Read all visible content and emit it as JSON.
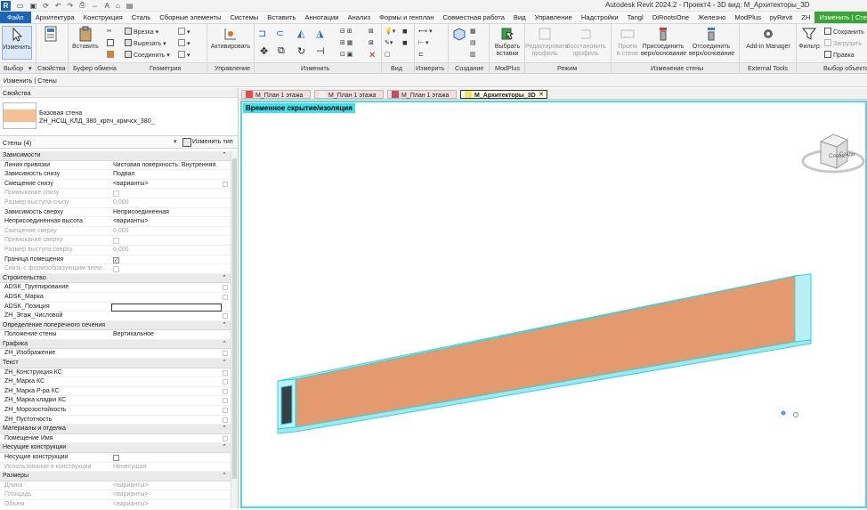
{
  "app": {
    "logo": "R",
    "title": "Autodesk Revit 2024.2 - Проект4 - 3D вид: М_Архитекторы_3D"
  },
  "ribbon_tabs": [
    "Файл",
    "Архитектура",
    "Конструкция",
    "Сталь",
    "Сборные элементы",
    "Системы",
    "Вставить",
    "Аннотации",
    "Анализ",
    "Формы и генплан",
    "Совместная работа",
    "Вид",
    "Управление",
    "Надстройки",
    "Tangl",
    "DiRootsOne",
    "Железно",
    "ModPlus",
    "pyRevit",
    "ZH",
    "Изменить | Стены"
  ],
  "ribbon": {
    "modify": "Изменить",
    "properties": "Свойства",
    "paste": "Вставить",
    "cut": "Врезка",
    "cut2": "Вырезать",
    "join": "Соединить",
    "activate": "Активировать",
    "select_inserts": "Выбрать\nвставки",
    "edit_profile": "Редактировать\nпрофиль",
    "reset_profile": "Восстановить\nпрофиль",
    "wall_opening": "Проем\nв стене",
    "attach": "Присоединить\nверх/основание",
    "detach": "Отсоединить\nверх/основание",
    "addin": "Add-in Manager",
    "filter": "Фильтр",
    "save": "Сохранить",
    "load": "Загрузить",
    "edit": "Правка"
  },
  "panels": [
    "Выбор",
    "Свойства",
    "Буфер обмена",
    "Геометрия",
    "Управление",
    "Изменить",
    "Вид",
    "Измерить",
    "Создание",
    "ModPlus",
    "Режим",
    "Изменение стены",
    "External Tools",
    "Выбор объектов"
  ],
  "options_bar": "Изменить | Стены",
  "properties": {
    "header": "Свойства",
    "type_name": "Базовая стена",
    "type_sub": "ZH_НСЩ_КЛД_380_крпч_крмчск_380_",
    "instance": "Стены (4)",
    "edit_type": "Изменить тип",
    "groups": [
      {
        "name": "Зависимости",
        "rows": [
          {
            "n": "Линия привязки",
            "v": "Чистовая поверхность: Внутренняя",
            "d": false
          },
          {
            "n": "Зависимость снизу",
            "v": "Подвал",
            "d": false
          },
          {
            "n": "Смещение снизу",
            "v": "<варианты>",
            "d": false,
            "box": true
          },
          {
            "n": "Примыкание снизу",
            "v": "",
            "d": true,
            "chk": ""
          },
          {
            "n": "Размер выступа снизу",
            "v": "0,000",
            "d": true
          },
          {
            "n": "Зависимость сверху",
            "v": "Неприсоединенная",
            "d": false
          },
          {
            "n": "Неприсоединенная высота",
            "v": "<варианты>",
            "d": false
          },
          {
            "n": "Смещение сверху",
            "v": "0,000",
            "d": true
          },
          {
            "n": "Примыкание сверху",
            "v": "",
            "d": true,
            "chk": ""
          },
          {
            "n": "Размер выступа сверху",
            "v": "0,000",
            "d": true
          },
          {
            "n": "Граница помещения",
            "v": "",
            "d": false,
            "chk": "✓"
          },
          {
            "n": "Связь с формообразующим элем...",
            "v": "",
            "d": true,
            "chk": ""
          }
        ]
      },
      {
        "name": "Строительство",
        "rows": [
          {
            "n": "ADSK_Группирование",
            "v": "",
            "d": false,
            "box": true
          },
          {
            "n": "ADSK_Марка",
            "v": "",
            "d": false,
            "box": true
          },
          {
            "n": "ADSK_Позиция",
            "v": "",
            "d": false,
            "input": true
          },
          {
            "n": "ZH_Этаж_Числовой",
            "v": "",
            "d": false,
            "box": true
          }
        ]
      },
      {
        "name": "Определение поперечного сечения",
        "rows": [
          {
            "n": "Положение стены",
            "v": "Вертикальное",
            "d": false
          }
        ]
      },
      {
        "name": "Графика",
        "rows": [
          {
            "n": "ZH_Изображение",
            "v": "",
            "d": false,
            "box": true
          }
        ]
      },
      {
        "name": "Текст",
        "rows": [
          {
            "n": "ZH_Конструкция КС",
            "v": "",
            "d": false,
            "box": true
          },
          {
            "n": "ZH_Марка КС",
            "v": "",
            "d": false,
            "box": true
          },
          {
            "n": "ZH_Марка Р-ра КС",
            "v": "",
            "d": false,
            "box": true
          },
          {
            "n": "ZH_Марка кладки КС",
            "v": "",
            "d": false,
            "box": true
          },
          {
            "n": "ZH_Морозостойкость",
            "v": "",
            "d": false,
            "box": true
          },
          {
            "n": "ZH_Пустотность",
            "v": "",
            "d": false,
            "box": true
          }
        ]
      },
      {
        "name": "Материалы и отделка",
        "rows": [
          {
            "n": "Помещение Имя",
            "v": "",
            "d": false,
            "box": true
          }
        ]
      },
      {
        "name": "Несущие конструкции",
        "rows": [
          {
            "n": "Несущие конструкции",
            "v": "",
            "d": false,
            "chk": ""
          },
          {
            "n": "Использование в конструкции",
            "v": "Ненесущая",
            "d": true
          }
        ]
      },
      {
        "name": "Размеры",
        "rows": [
          {
            "n": "Длина",
            "v": "<варианты>",
            "d": true
          },
          {
            "n": "Площадь",
            "v": "<варианты>",
            "d": true
          },
          {
            "n": "Объем",
            "v": "<варианты>",
            "d": true
          }
        ]
      }
    ]
  },
  "view_tabs": [
    {
      "label": "М_План 1 этажа",
      "color": "#e84a4a",
      "active": false
    },
    {
      "label": "М_План 1 этажа",
      "color": "#f0f0f0",
      "active": false
    },
    {
      "label": "М_План 1 этажа",
      "color": "#c24a6a",
      "active": false
    },
    {
      "label": "М_Архитекторы_3D",
      "color": "#f2e36a",
      "active": true
    }
  ],
  "viewport": {
    "banner": "Временное скрытие/изоляция",
    "viewcube": {
      "left": "Слева",
      "front": "Сзади"
    },
    "wall_color": "#e29a6e",
    "highlight_color": "#3fe0ea"
  }
}
